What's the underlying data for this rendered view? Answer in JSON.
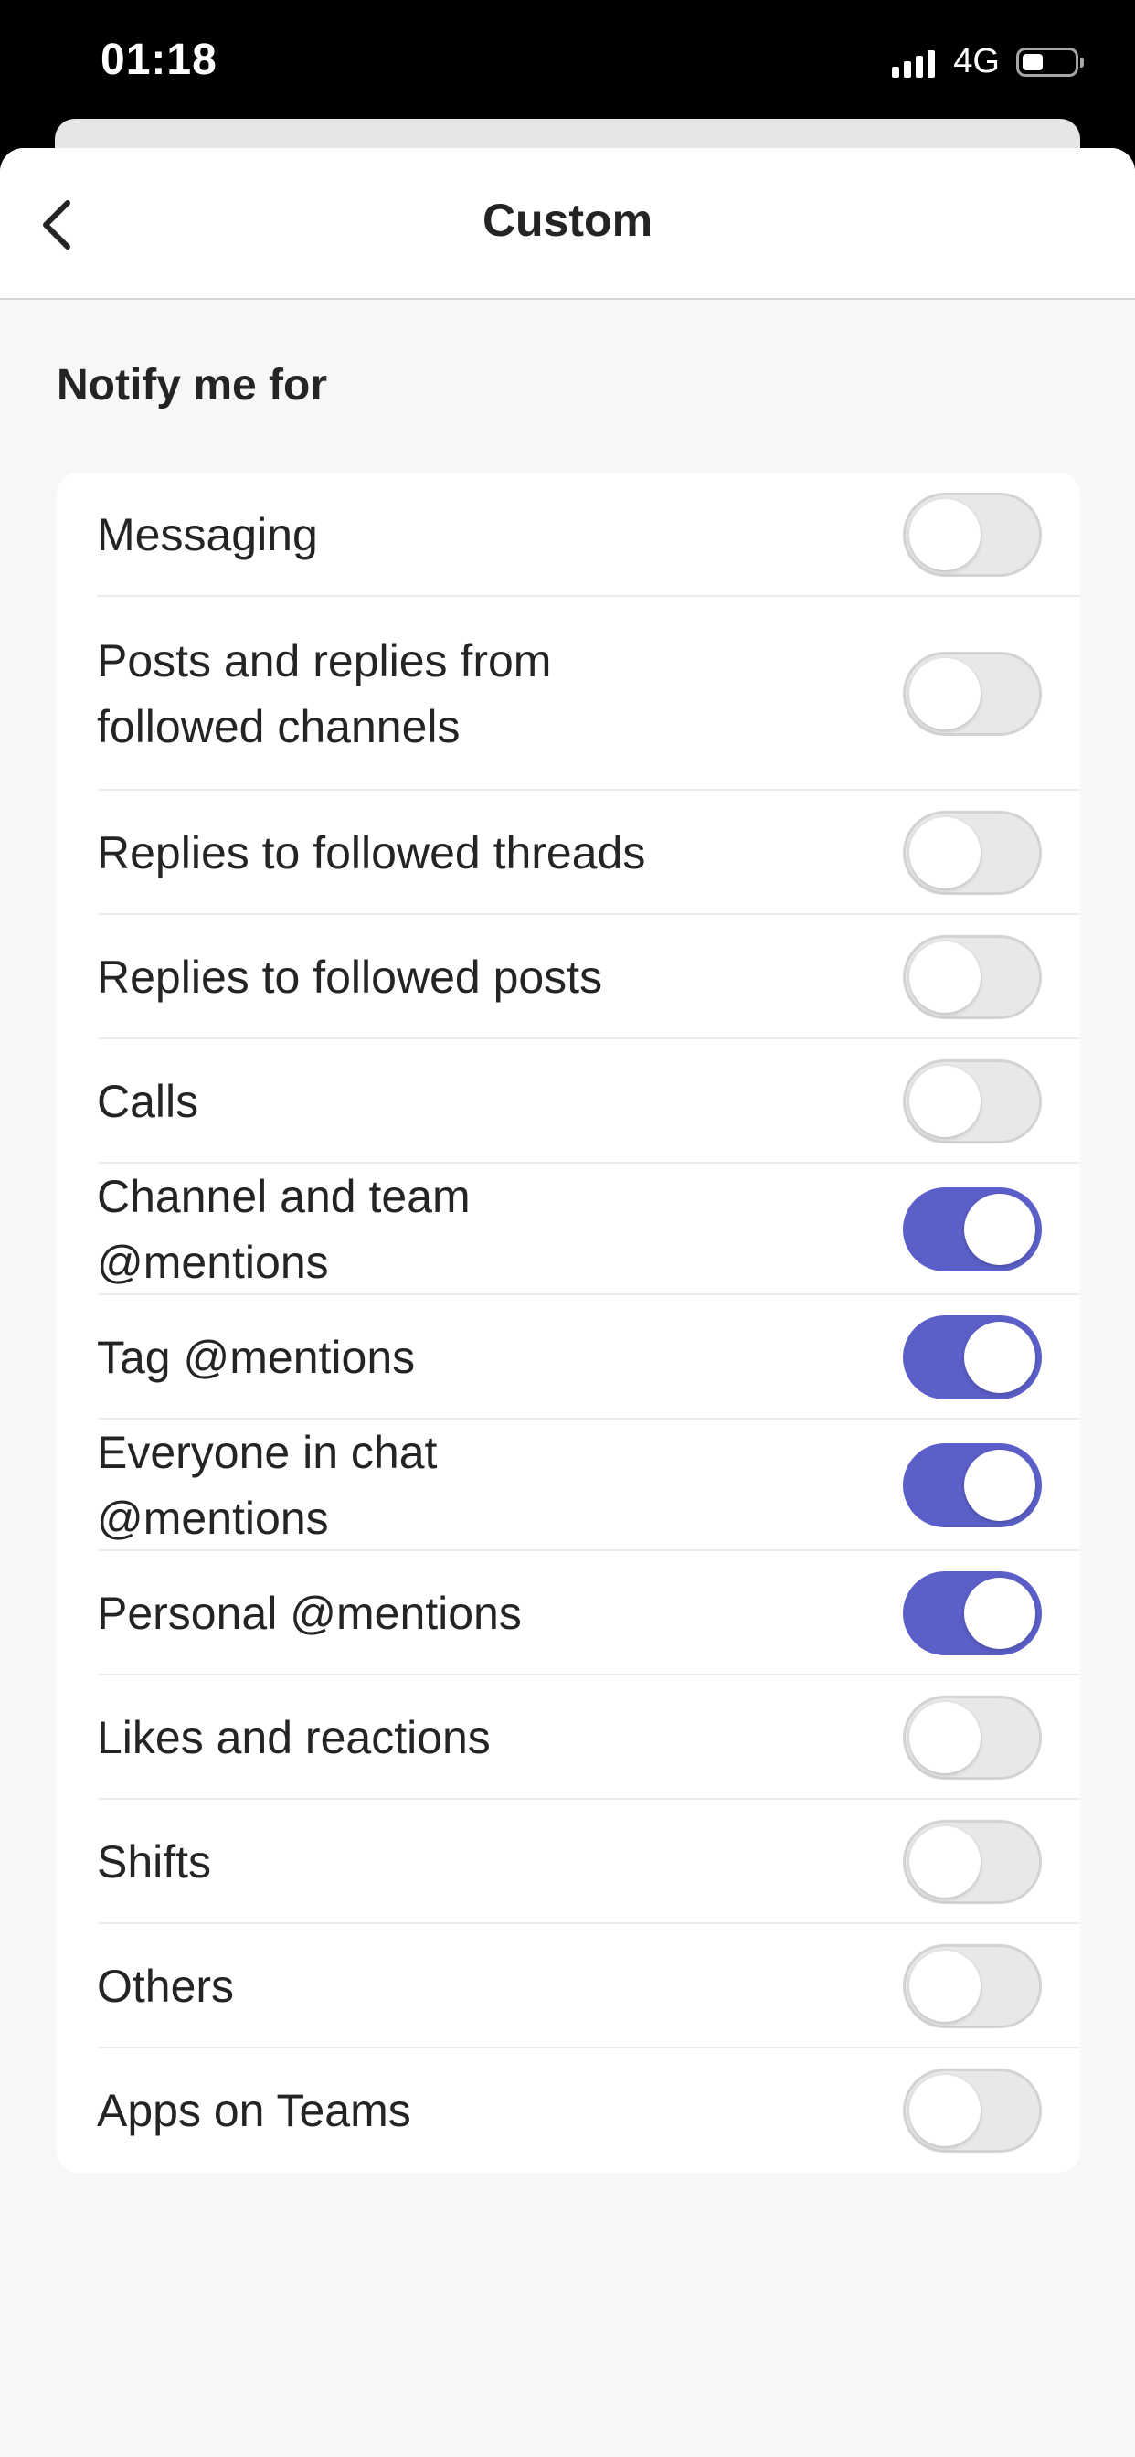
{
  "status_bar": {
    "time": "01:18",
    "network": "4G",
    "signal_icon": "cellular-signal-icon",
    "battery_icon": "battery-icon"
  },
  "header": {
    "title": "Custom",
    "back_icon": "chevron-left-icon"
  },
  "section": {
    "title": "Notify me for"
  },
  "colors": {
    "accent": "#5b5fc7",
    "toggle_off": "#e8e8ea",
    "background": "#f7f7f7"
  },
  "items": [
    {
      "label": "Messaging",
      "enabled": false
    },
    {
      "label": "Posts and replies from followed channels",
      "enabled": false
    },
    {
      "label": "Replies to followed threads",
      "enabled": false
    },
    {
      "label": "Replies to followed posts",
      "enabled": false
    },
    {
      "label": "Calls",
      "enabled": false
    },
    {
      "label": "Channel and team @mentions",
      "enabled": true
    },
    {
      "label": "Tag @mentions",
      "enabled": true
    },
    {
      "label": "Everyone in chat @mentions",
      "enabled": true
    },
    {
      "label": "Personal @mentions",
      "enabled": true
    },
    {
      "label": "Likes and reactions",
      "enabled": false
    },
    {
      "label": "Shifts",
      "enabled": false
    },
    {
      "label": "Others",
      "enabled": false
    },
    {
      "label": "Apps on Teams",
      "enabled": false
    }
  ]
}
